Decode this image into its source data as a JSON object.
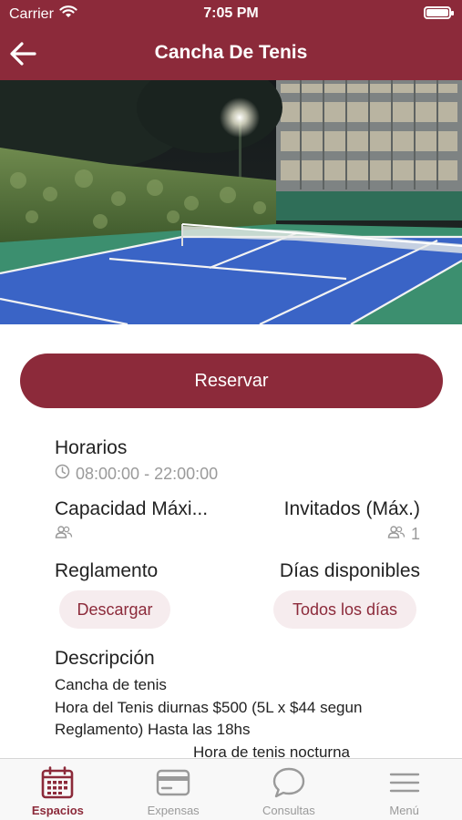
{
  "status_bar": {
    "carrier": "Carrier",
    "time": "7:05 PM"
  },
  "nav": {
    "title": "Cancha De Tenis"
  },
  "reserve": {
    "label": "Reservar"
  },
  "horarios": {
    "label": "Horarios",
    "value": "08:00:00 - 22:00:00"
  },
  "capacidad": {
    "label": "Capacidad Máxi...",
    "value": ""
  },
  "invitados": {
    "label": "Invitados (Máx.)",
    "value": "1"
  },
  "reglamento": {
    "label": "Reglamento",
    "button": "Descargar"
  },
  "dias": {
    "label": "Días disponibles",
    "button": "Todos los días"
  },
  "descripcion": {
    "label": "Descripción",
    "lines": [
      "Cancha de tenis",
      "Hora del Tenis diurnas $500 (5L x $44 segun",
      "Reglamento) Hasta las 18hs",
      "Hora de tenis nocturna"
    ]
  },
  "tabs": [
    {
      "label": "Espacios",
      "icon": "calendar-icon",
      "active": true
    },
    {
      "label": "Expensas",
      "icon": "credit-card-icon",
      "active": false
    },
    {
      "label": "Consultas",
      "icon": "chat-bubble-icon",
      "active": false
    },
    {
      "label": "Menú",
      "icon": "hamburger-menu-icon",
      "active": false
    }
  ],
  "colors": {
    "brand": "#8c2a3a",
    "muted": "#9a9a9a",
    "pill_bg": "#f6ecee"
  }
}
